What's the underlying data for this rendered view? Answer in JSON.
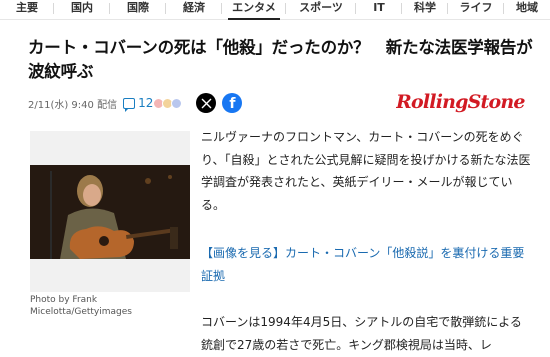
{
  "nav": {
    "items": [
      {
        "label": "主要"
      },
      {
        "label": "国内"
      },
      {
        "label": "国際"
      },
      {
        "label": "経済"
      },
      {
        "label": "エンタメ"
      },
      {
        "label": "スポーツ"
      },
      {
        "label": "IT"
      },
      {
        "label": "科学"
      },
      {
        "label": "ライフ"
      },
      {
        "label": "地域"
      }
    ],
    "active_index": 4
  },
  "article": {
    "headline": "カート・コバーンの死は「他殺」だったのか？　新たな法医学報告が波紋呼ぶ",
    "date": "2/11(水) 9:40 配信",
    "comment_count": "12",
    "share_x_icon": "x-logo-icon",
    "share_fb_icon": "facebook-icon",
    "source_logo": "RollingStone",
    "photo_caption": "Photo by Frank Micelotta/Gettyimages",
    "paragraph1": "ニルヴァーナのフロントマン、カート・コバーンの死をめぐり、「自殺」とされた公式見解に疑問を投げかける新たな法医学調査が発表されたと、英紙デイリー・メールが報じている。",
    "related_link": "【画像を見る】カート・コバーン「他殺説」を裏付ける重要証拠",
    "paragraph2": "コバーンは1994年4月5日、シアトルの自宅で散弾銃による銃創で27歳の若さで死亡。キング郡検視局は当時、レ"
  },
  "colors": {
    "link": "#1a6ab0",
    "comment": "#1a7ec1",
    "logo": "#d21a23",
    "facebook": "#1877f2"
  }
}
